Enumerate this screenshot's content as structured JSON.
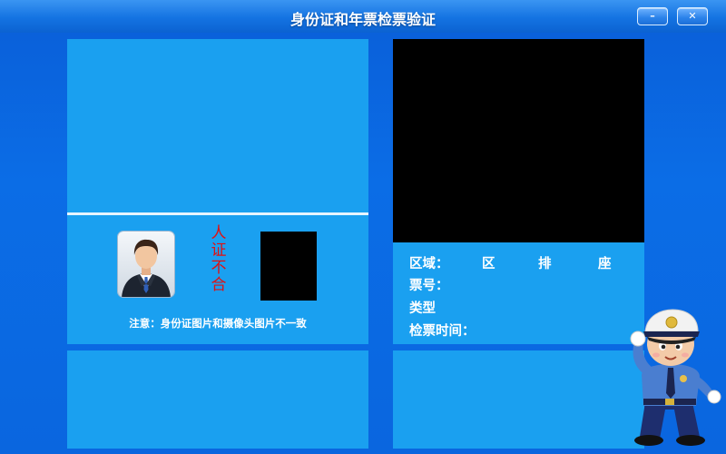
{
  "window": {
    "title": "身份证和年票检票验证",
    "minimize_label": "–",
    "close_label": "✕"
  },
  "left": {
    "avatar_icon": "businessman-avatar-icon",
    "verification_result": [
      "人",
      "证",
      "不",
      "合"
    ],
    "notice": "注意：身份证图片和摄像头图片不一致"
  },
  "right": {
    "zone_label": "区域：",
    "zone_parts": [
      "区",
      "排",
      "座"
    ],
    "ticket_no_label": "票号：",
    "type_label": "类型",
    "check_time_label": "检票时间："
  },
  "mascot_icon": "police-officer-salute-icon",
  "colors": {
    "background": "#0a66df",
    "panel": "#1aa0f0",
    "alert_text": "#e11010"
  }
}
